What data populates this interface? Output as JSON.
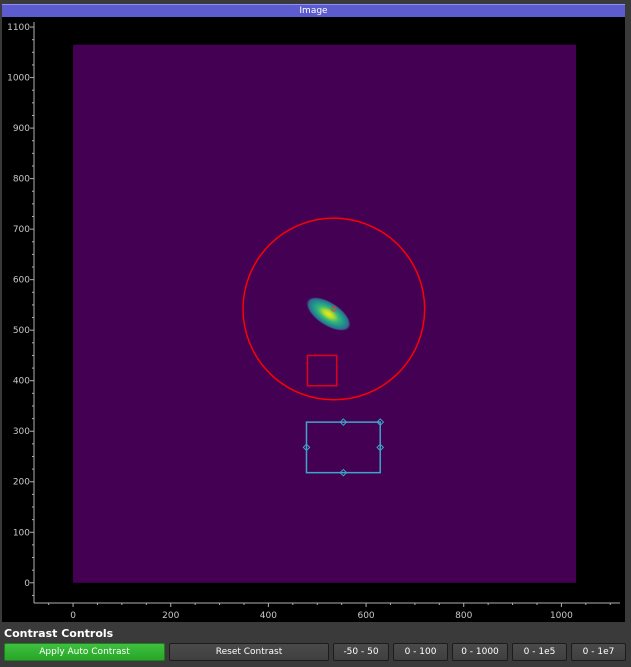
{
  "window": {
    "title": "Image"
  },
  "plot": {
    "x_ticks": [
      "0",
      "200",
      "400",
      "600",
      "800",
      "1000"
    ],
    "y_ticks": [
      "0",
      "100",
      "200",
      "300",
      "400",
      "500",
      "600",
      "700",
      "800",
      "900",
      "1000",
      "1100"
    ],
    "x_range": [
      -80,
      1120
    ],
    "y_range": [
      -40,
      1110
    ],
    "image_extent": {
      "x": [
        0,
        1030
      ],
      "y": [
        0,
        1065
      ]
    },
    "hotspot_center": [
      523,
      532
    ],
    "circle_roi": {
      "center": [
        534,
        542
      ],
      "radius": 186
    },
    "square_roi": {
      "x": [
        480,
        540
      ],
      "y": [
        390,
        450
      ]
    },
    "rect_roi": {
      "x": [
        478,
        629
      ],
      "y": [
        218,
        318
      ]
    },
    "marker": [
      534,
      542
    ],
    "colors": {
      "background": "#000000",
      "image": "#440154",
      "circle_roi": "#ff0000",
      "square_roi": "#e0001a",
      "rect_roi": "#3fa4c8",
      "axis": "#b0b0b0"
    }
  },
  "controls": {
    "title": "Contrast Controls",
    "buttons": [
      "Apply Auto Contrast",
      "Reset Contrast",
      "-50 - 50",
      "0 - 100",
      "0 - 1000",
      "0 - 1e5",
      "0 - 1e7"
    ]
  }
}
